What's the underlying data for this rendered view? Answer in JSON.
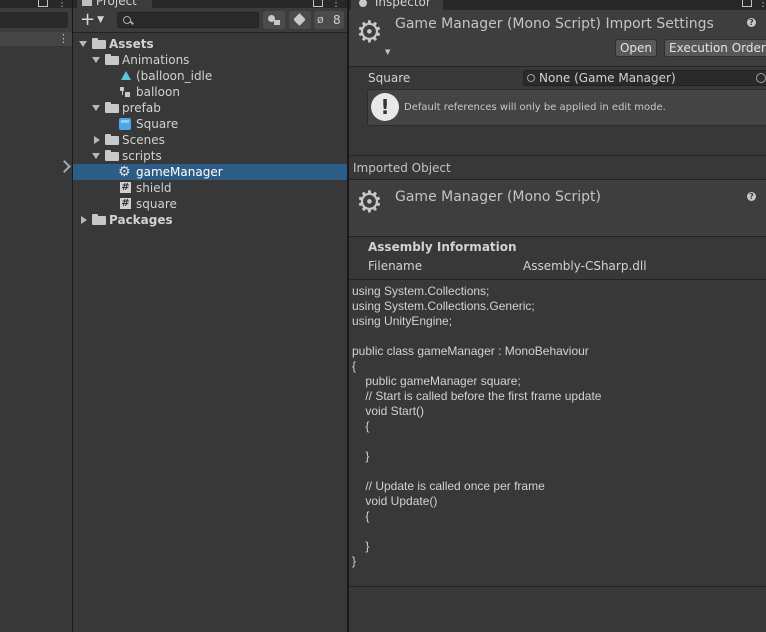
{
  "project": {
    "tab_label": "Project",
    "hidden_count": "8",
    "tree": [
      {
        "label": "Assets",
        "bold": true
      },
      {
        "label": "Animations"
      },
      {
        "label": "(balloon_idle"
      },
      {
        "label": "balloon"
      },
      {
        "label": "prefab"
      },
      {
        "label": "Square"
      },
      {
        "label": "Scenes"
      },
      {
        "label": "scripts"
      },
      {
        "label": "gameManager"
      },
      {
        "label": "shield"
      },
      {
        "label": "square"
      },
      {
        "label": "Packages",
        "bold": true
      }
    ]
  },
  "inspector": {
    "tab_label": "Inspector",
    "header_title": "Game Manager (Mono Script) Import Settings",
    "open_button": "Open",
    "execution_order_button": "Execution Order...",
    "field_label": "Square",
    "field_value": "None (Game Manager)",
    "help_text": "Default references will only be applied in edit mode.",
    "imported_object_label": "Imported Object",
    "script_title": "Game Manager (Mono Script)",
    "assembly_heading": "Assembly Information",
    "filename_label": "Filename",
    "filename_value": "Assembly-CSharp.dll",
    "code_lines": [
      "using System.Collections;",
      "using System.Collections.Generic;",
      "using UnityEngine;",
      "",
      "public class gameManager : MonoBehaviour",
      "{",
      "    public gameManager square;",
      "    // Start is called before the first frame update",
      "    void Start()",
      "    {",
      "",
      "    }",
      "",
      "    // Update is called once per frame",
      "    void Update()",
      "    {",
      "",
      "    }",
      "}"
    ]
  },
  "colors": {
    "selection": "#2c5d87",
    "panel_bg": "#383838",
    "toolbar_bg": "#3c3c3c",
    "script_icon": "#d0d0d0",
    "prefab_icon": "#4ea6e6",
    "anim_icon": "#5ec6d6"
  }
}
